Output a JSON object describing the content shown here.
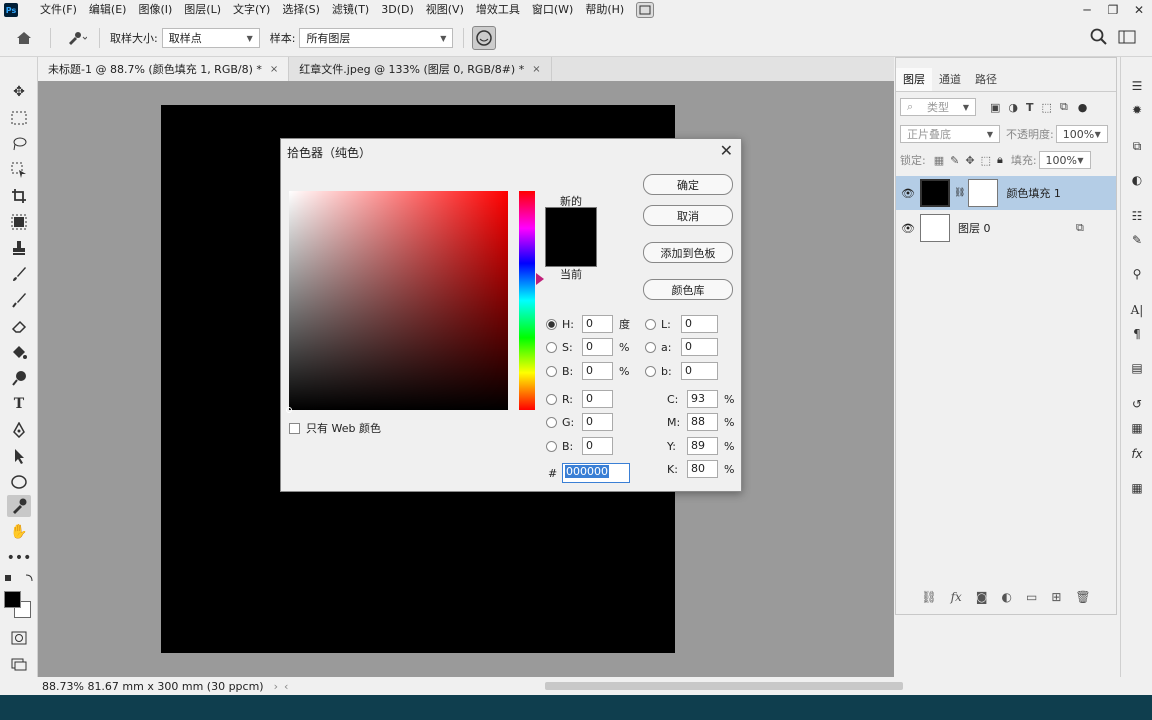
{
  "app": {
    "logo_text": "Ps",
    "menu": [
      "文件(F)",
      "编辑(E)",
      "图像(I)",
      "图层(L)",
      "文字(Y)",
      "选择(S)",
      "滤镜(T)",
      "3D(D)",
      "视图(V)",
      "增效工具",
      "窗口(W)",
      "帮助(H)"
    ]
  },
  "window_controls": {
    "minimize": "─",
    "restore": "❐",
    "close": "✕"
  },
  "options": {
    "sample_size_label": "取样大小:",
    "sample_size_value": "取样点",
    "sample_label": "样本:",
    "sample_value": "所有图层"
  },
  "tabs": [
    {
      "label": "未标题-1 @ 88.7% (颜色填充 1, RGB/8) *",
      "close": "×"
    },
    {
      "label": "红章文件.jpeg @ 133% (图层 0, RGB/8#) *",
      "close": "×"
    }
  ],
  "status": {
    "text": "88.73%  81.67 mm x 300 mm (30 ppcm)"
  },
  "layers_panel": {
    "tabs": [
      "图层",
      "通道",
      "路径"
    ],
    "filter_placeholder": "类型",
    "blend_mode": "正片叠底",
    "opacity_label": "不透明度:",
    "opacity_value": "100%",
    "lock_label": "锁定:",
    "fill_label": "填充:",
    "fill_value": "100%",
    "layers": [
      {
        "name": "颜色填充 1",
        "selected": true
      },
      {
        "name": "图层 0",
        "selected": false
      }
    ]
  },
  "color_picker": {
    "title": "拾色器（纯色）",
    "new_label": "新的",
    "current_label": "当前",
    "buttons": {
      "ok": "确定",
      "cancel": "取消",
      "add_swatch": "添加到色板",
      "libraries": "颜色库"
    },
    "web_only_label": "只有 Web 颜色",
    "fields": {
      "H": {
        "label": "H:",
        "value": "0",
        "unit": "度"
      },
      "S": {
        "label": "S:",
        "value": "0",
        "unit": "%"
      },
      "Bv": {
        "label": "B:",
        "value": "0",
        "unit": "%"
      },
      "R": {
        "label": "R:",
        "value": "0"
      },
      "G": {
        "label": "G:",
        "value": "0"
      },
      "Bc": {
        "label": "B:",
        "value": "0"
      },
      "L": {
        "label": "L:",
        "value": "0"
      },
      "a": {
        "label": "a:",
        "value": "0"
      },
      "b": {
        "label": "b:",
        "value": "0"
      },
      "C": {
        "label": "C:",
        "value": "93",
        "unit": "%"
      },
      "M": {
        "label": "M:",
        "value": "88",
        "unit": "%"
      },
      "Y": {
        "label": "Y:",
        "value": "89",
        "unit": "%"
      },
      "K": {
        "label": "K:",
        "value": "80",
        "unit": "%"
      }
    },
    "hex_label": "#",
    "hex_value": "000000",
    "new_color": "#000000",
    "current_color": "#000000"
  }
}
